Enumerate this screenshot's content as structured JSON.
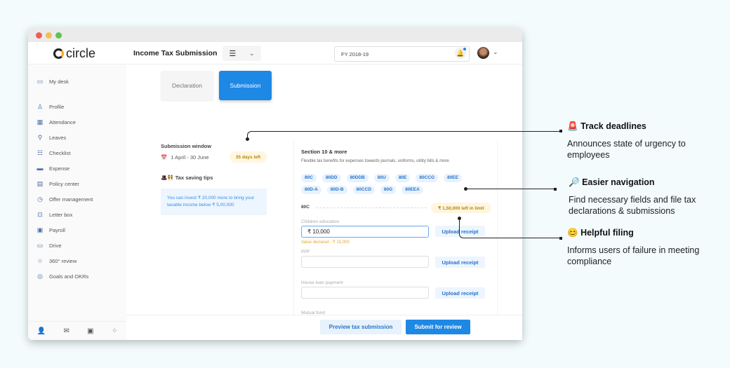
{
  "app": {
    "logo": "circle"
  },
  "sidebar": {
    "items": [
      {
        "label": "My desk",
        "icon": "monitor-icon"
      },
      {
        "label": "Profile",
        "icon": "user-icon"
      },
      {
        "label": "Attendance",
        "icon": "calendar-icon"
      },
      {
        "label": "Leaves",
        "icon": "leave-icon"
      },
      {
        "label": "Checklist",
        "icon": "checklist-icon"
      },
      {
        "label": "Expense",
        "icon": "card-icon"
      },
      {
        "label": "Policy center",
        "icon": "book-icon"
      },
      {
        "label": "Offer management",
        "icon": "clock-icon"
      },
      {
        "label": "Letter box",
        "icon": "inbox-icon"
      },
      {
        "label": "Payroll",
        "icon": "payroll-icon"
      },
      {
        "label": "Drive",
        "icon": "folder-icon"
      },
      {
        "label": "360° review",
        "icon": "star-icon"
      },
      {
        "label": "Goals and OKRs",
        "icon": "target-icon"
      }
    ]
  },
  "main": {
    "title": "Income Tax Submission",
    "fy": "FY 2018-19",
    "tabs": [
      {
        "label": "Declaration",
        "active": false
      },
      {
        "label": "Submission",
        "active": true
      }
    ],
    "window_label": "Submission window",
    "window_dates": "1 April - 30 June",
    "days_left": "35 days left",
    "tips_title": "🎩👯 Tax saving tips",
    "tip_line1": "You can invest ₹ 20,000 more to bring your",
    "tip_line2": "taxable income below   ₹ 5,00,000",
    "section_title": "Section 10 & more",
    "section_desc": "Flexible tax benefits for expenses towards journals, uniforms, utility bills & more",
    "chips": [
      "80C",
      "80DD",
      "80DDB",
      "80U",
      "80E",
      "80CCG",
      "80EE",
      "80D-A",
      "80D-B",
      "80CCD",
      "80G",
      "80EEA"
    ],
    "subsection": "80C",
    "limit": "₹ 1,50,000 left in limit",
    "fields": [
      {
        "label": "Children education",
        "value": "₹  10,000",
        "note": "Value declared - ₹ 15,000"
      },
      {
        "label": "PPF",
        "value": ""
      },
      {
        "label": "House loan payment",
        "value": ""
      },
      {
        "label": "Mutual fund"
      }
    ],
    "upload_label": "Upload receipt",
    "preview_label": "Preview tax submission",
    "submit_label": "Submit for review"
  },
  "annotations": [
    {
      "emoji": "🚨",
      "title": "Track deadlines",
      "desc": "Announces state of urgency to employees"
    },
    {
      "emoji": "🔎",
      "title": "Easier navigation",
      "desc": "Find necessary fields and file tax declarations & submissions"
    },
    {
      "emoji": "😊",
      "title": "Helpful filing",
      "desc": "Informs users of failure in meeting compliance"
    }
  ],
  "colors": {
    "accent": "#1e88e5",
    "background": "#f3fbfd",
    "warning": "#b8860b"
  }
}
